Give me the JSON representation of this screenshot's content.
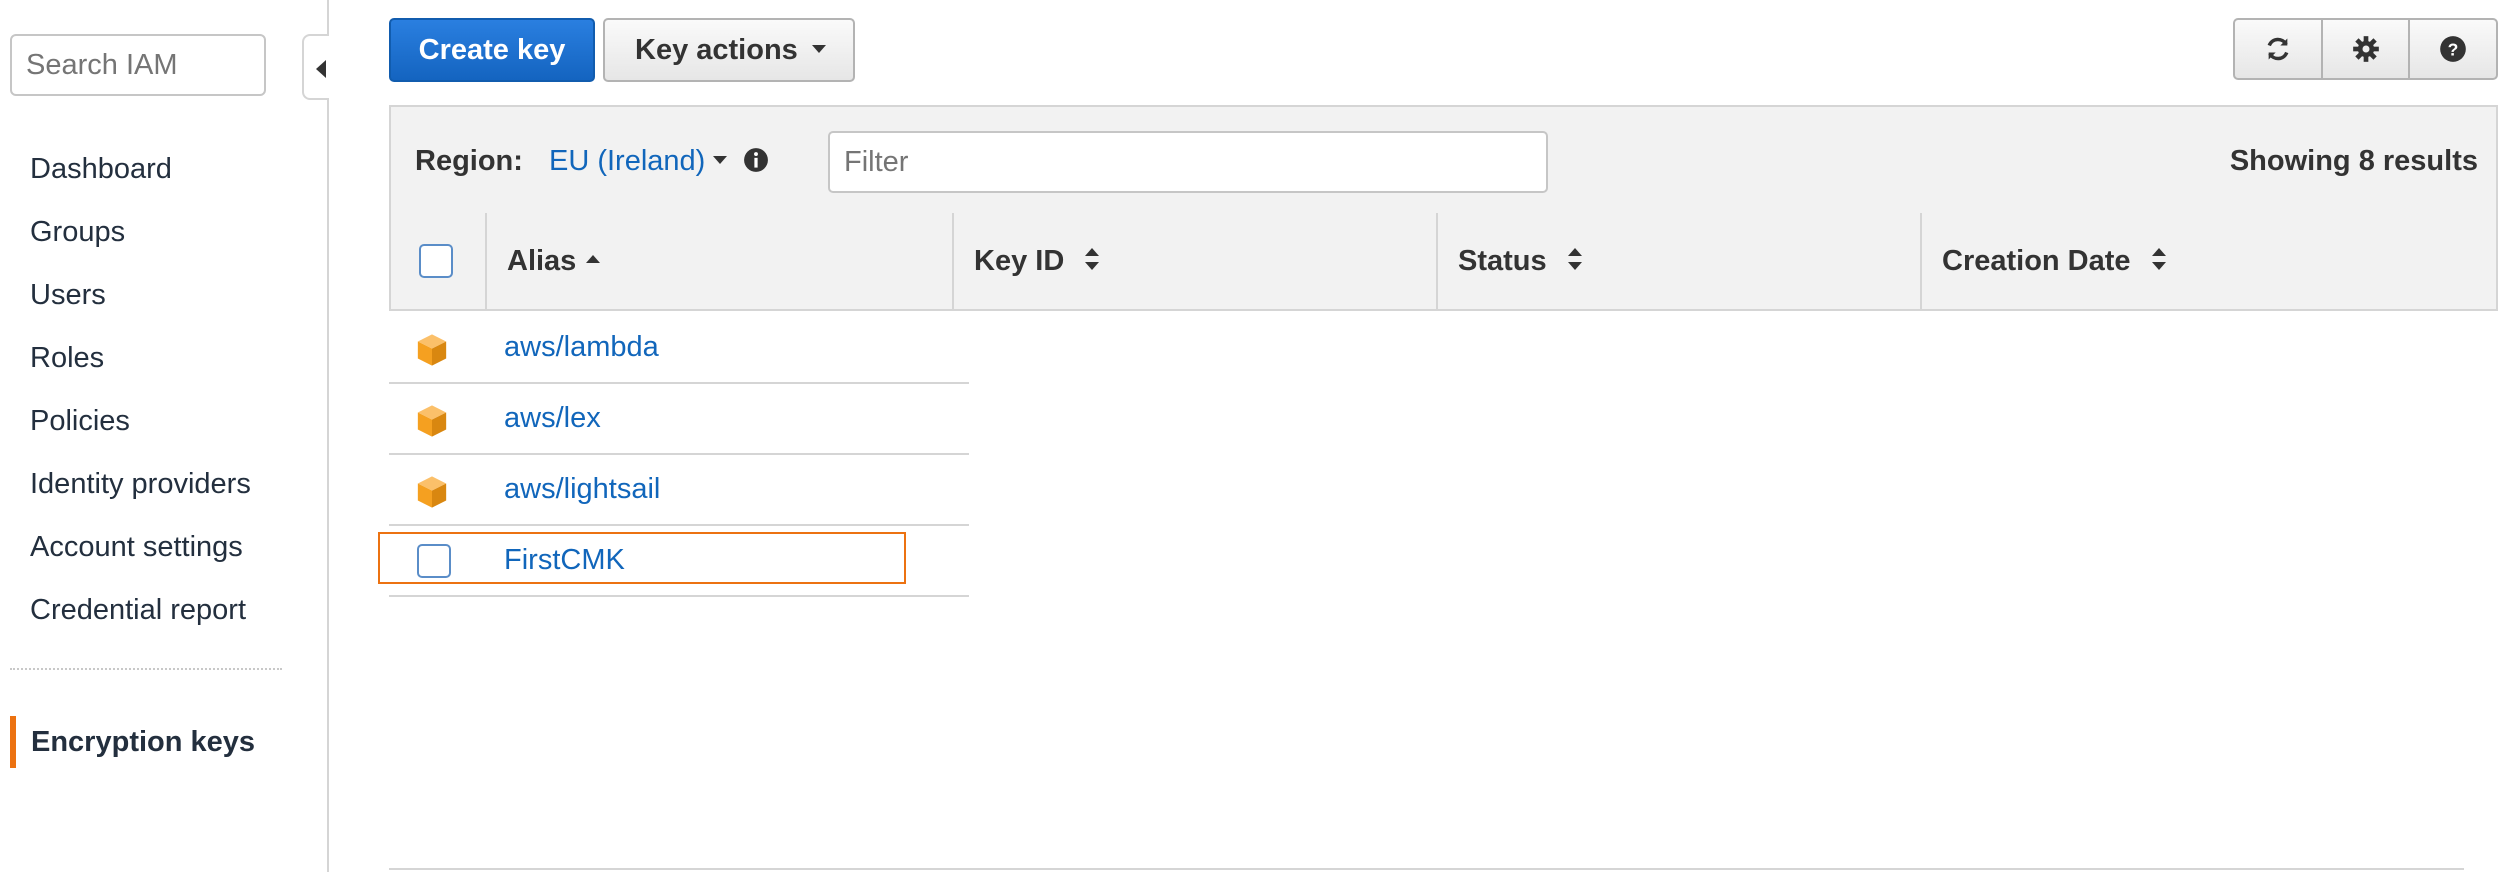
{
  "sidebar": {
    "search_placeholder": "Search IAM",
    "items": [
      {
        "label": "Dashboard"
      },
      {
        "label": "Groups"
      },
      {
        "label": "Users"
      },
      {
        "label": "Roles"
      },
      {
        "label": "Policies"
      },
      {
        "label": "Identity providers"
      },
      {
        "label": "Account settings"
      },
      {
        "label": "Credential report"
      }
    ],
    "active_item": "Encryption keys"
  },
  "toolbar": {
    "create_label": "Create key",
    "actions_label": "Key actions",
    "icons": [
      "refresh-icon",
      "gear-icon",
      "help-icon"
    ]
  },
  "filter_bar": {
    "region_label": "Region:",
    "region_value": "EU (Ireland)",
    "filter_placeholder": "Filter",
    "results_text": "Showing 8 results"
  },
  "table": {
    "columns": [
      {
        "label": "Alias",
        "sort": "ascending"
      },
      {
        "label": "Key ID",
        "sort": "none"
      },
      {
        "label": "Status",
        "sort": "none"
      },
      {
        "label": "Creation Date",
        "sort": "none"
      }
    ],
    "rows": [
      {
        "alias": "aws/lambda",
        "icon": "aws-managed-key-icon"
      },
      {
        "alias": "aws/lex",
        "icon": "aws-managed-key-icon"
      },
      {
        "alias": "aws/lightsail",
        "icon": "aws-managed-key-icon"
      },
      {
        "alias": "FirstCMK",
        "icon": "checkbox",
        "highlighted": true
      }
    ]
  },
  "colors": {
    "primary": "#1464c0",
    "link": "#1166bb",
    "accent": "#ec7211",
    "cube": "#f5a020"
  }
}
